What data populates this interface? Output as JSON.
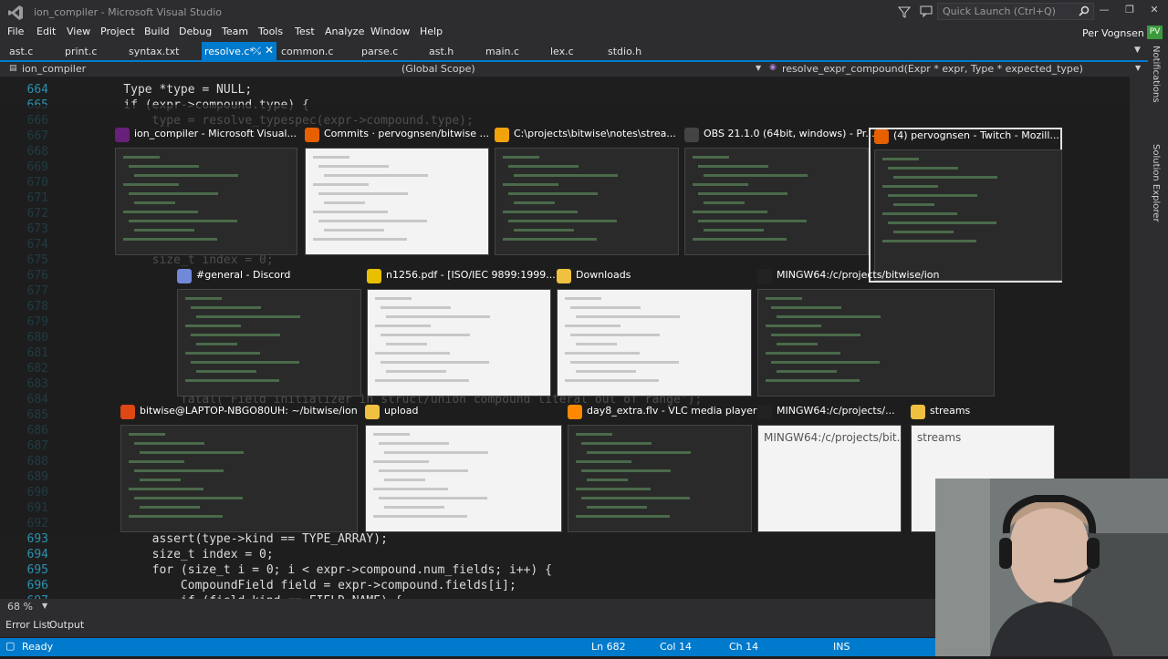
{
  "window": {
    "title": "ion_compiler - Microsoft Visual Studio",
    "quick_launch_placeholder": "Quick Launch (Ctrl+Q)",
    "user_name": "Per Vognsen",
    "user_initials": "PV"
  },
  "menu": [
    "File",
    "Edit",
    "View",
    "Project",
    "Build",
    "Debug",
    "Team",
    "Tools",
    "Test",
    "Analyze",
    "Window",
    "Help"
  ],
  "tabs": [
    "ast.c",
    "print.c",
    "syntax.txt",
    "resolve.c*",
    "common.c",
    "parse.c",
    "ast.h",
    "main.c",
    "lex.c",
    "stdio.h"
  ],
  "active_tab": "resolve.c*",
  "navbar": {
    "project": "ion_compiler",
    "scope": "(Global Scope)",
    "function": "resolve_expr_compound(Expr * expr, Type * expected_type)"
  },
  "code_lines": [
    {
      "n": "664",
      "t": "    Type *type = NULL;"
    },
    {
      "n": "665",
      "t": "    if (expr->compound.type) {"
    },
    {
      "n": "666",
      "t": "        type = resolve_typespec(expr->compound.type);"
    },
    {
      "n": "667",
      "t": ""
    },
    {
      "n": "668",
      "t": ""
    },
    {
      "n": "669",
      "t": ""
    },
    {
      "n": "670",
      "t": ""
    },
    {
      "n": "671",
      "t": ""
    },
    {
      "n": "672",
      "t": ""
    },
    {
      "n": "673",
      "t": ""
    },
    {
      "n": "674",
      "t": ""
    },
    {
      "n": "675",
      "t": "        size_t index = 0;"
    },
    {
      "n": "676",
      "t": ""
    },
    {
      "n": "677",
      "t": ""
    },
    {
      "n": "678",
      "t": ""
    },
    {
      "n": "679",
      "t": ""
    },
    {
      "n": "680",
      "t": ""
    },
    {
      "n": "681",
      "t": ""
    },
    {
      "n": "682",
      "t": ""
    },
    {
      "n": "683",
      "t": ""
    },
    {
      "n": "684",
      "t": "            fatal(\"Field initializer in struct/union compound literal out of range\");"
    },
    {
      "n": "685",
      "t": ""
    },
    {
      "n": "686",
      "t": ""
    },
    {
      "n": "687",
      "t": ""
    },
    {
      "n": "688",
      "t": ""
    },
    {
      "n": "689",
      "t": ""
    },
    {
      "n": "690",
      "t": ""
    },
    {
      "n": "691",
      "t": ""
    },
    {
      "n": "692",
      "t": ""
    },
    {
      "n": "693",
      "t": "        assert(type->kind == TYPE_ARRAY);"
    },
    {
      "n": "694",
      "t": "        size_t index = 0;"
    },
    {
      "n": "695",
      "t": "        for (size_t i = 0; i < expr->compound.num_fields; i++) {"
    },
    {
      "n": "696",
      "t": "            CompoundField field = expr->compound.fields[i];"
    },
    {
      "n": "697",
      "t": "            if (field.kind == FIELD_NAME) {"
    }
  ],
  "switcher_windows": [
    {
      "label": "ion_compiler - Microsoft Visual...",
      "icon_color": "#68217a",
      "theme": "dark"
    },
    {
      "label": "Commits · pervognsen/bitwise ...",
      "icon_color": "#e66000",
      "theme": "light"
    },
    {
      "label": "C:\\projects\\bitwise\\notes\\strea...",
      "icon_color": "#f0a30a",
      "theme": "dark"
    },
    {
      "label": "OBS 21.1.0 (64bit, windows) - Pr...",
      "icon_color": "#444444",
      "theme": "dark"
    },
    {
      "label": "(4) pervognsen - Twitch - Mozill...",
      "icon_color": "#e66000",
      "theme": "dark",
      "selected": true
    },
    {
      "label": "#general - Discord",
      "icon_color": "#7289da",
      "theme": "dark"
    },
    {
      "label": "n1256.pdf - [ISO/IEC 9899:1999...",
      "icon_color": "#e8c000",
      "theme": "light"
    },
    {
      "label": "Downloads",
      "icon_color": "#f0c040",
      "theme": "light"
    },
    {
      "label": "MINGW64:/c/projects/bitwise/ion",
      "icon_color": "#222222",
      "theme": "dark"
    },
    {
      "label": "bitwise@LAPTOP-NBGO80UH: ~/bitwise/ion",
      "icon_color": "#dd4814",
      "theme": "dark"
    },
    {
      "label": "upload",
      "icon_color": "#f0c040",
      "theme": "light"
    },
    {
      "label": "day8_extra.flv - VLC media player",
      "icon_color": "#ff8800",
      "theme": "dark"
    },
    {
      "label": "MINGW64:/c/projects/...",
      "icon_color": "#222222",
      "theme": "light",
      "preview_text": "MINGW64:/c/projects/bit..."
    },
    {
      "label": "streams",
      "icon_color": "#f0c040",
      "theme": "light",
      "preview_text": "streams"
    }
  ],
  "side_panel": [
    "Notifications",
    "Solution Explorer"
  ],
  "zoom": "68 %",
  "bottom_tabs": [
    "Error List",
    "Output"
  ],
  "status": {
    "state": "Ready",
    "line": "Ln 682",
    "col": "Col 14",
    "ch": "Ch 14",
    "mode": "INS"
  },
  "colors": {
    "accent": "#007acc",
    "background": "#1e1e1e",
    "chrome": "#2d2d30"
  }
}
